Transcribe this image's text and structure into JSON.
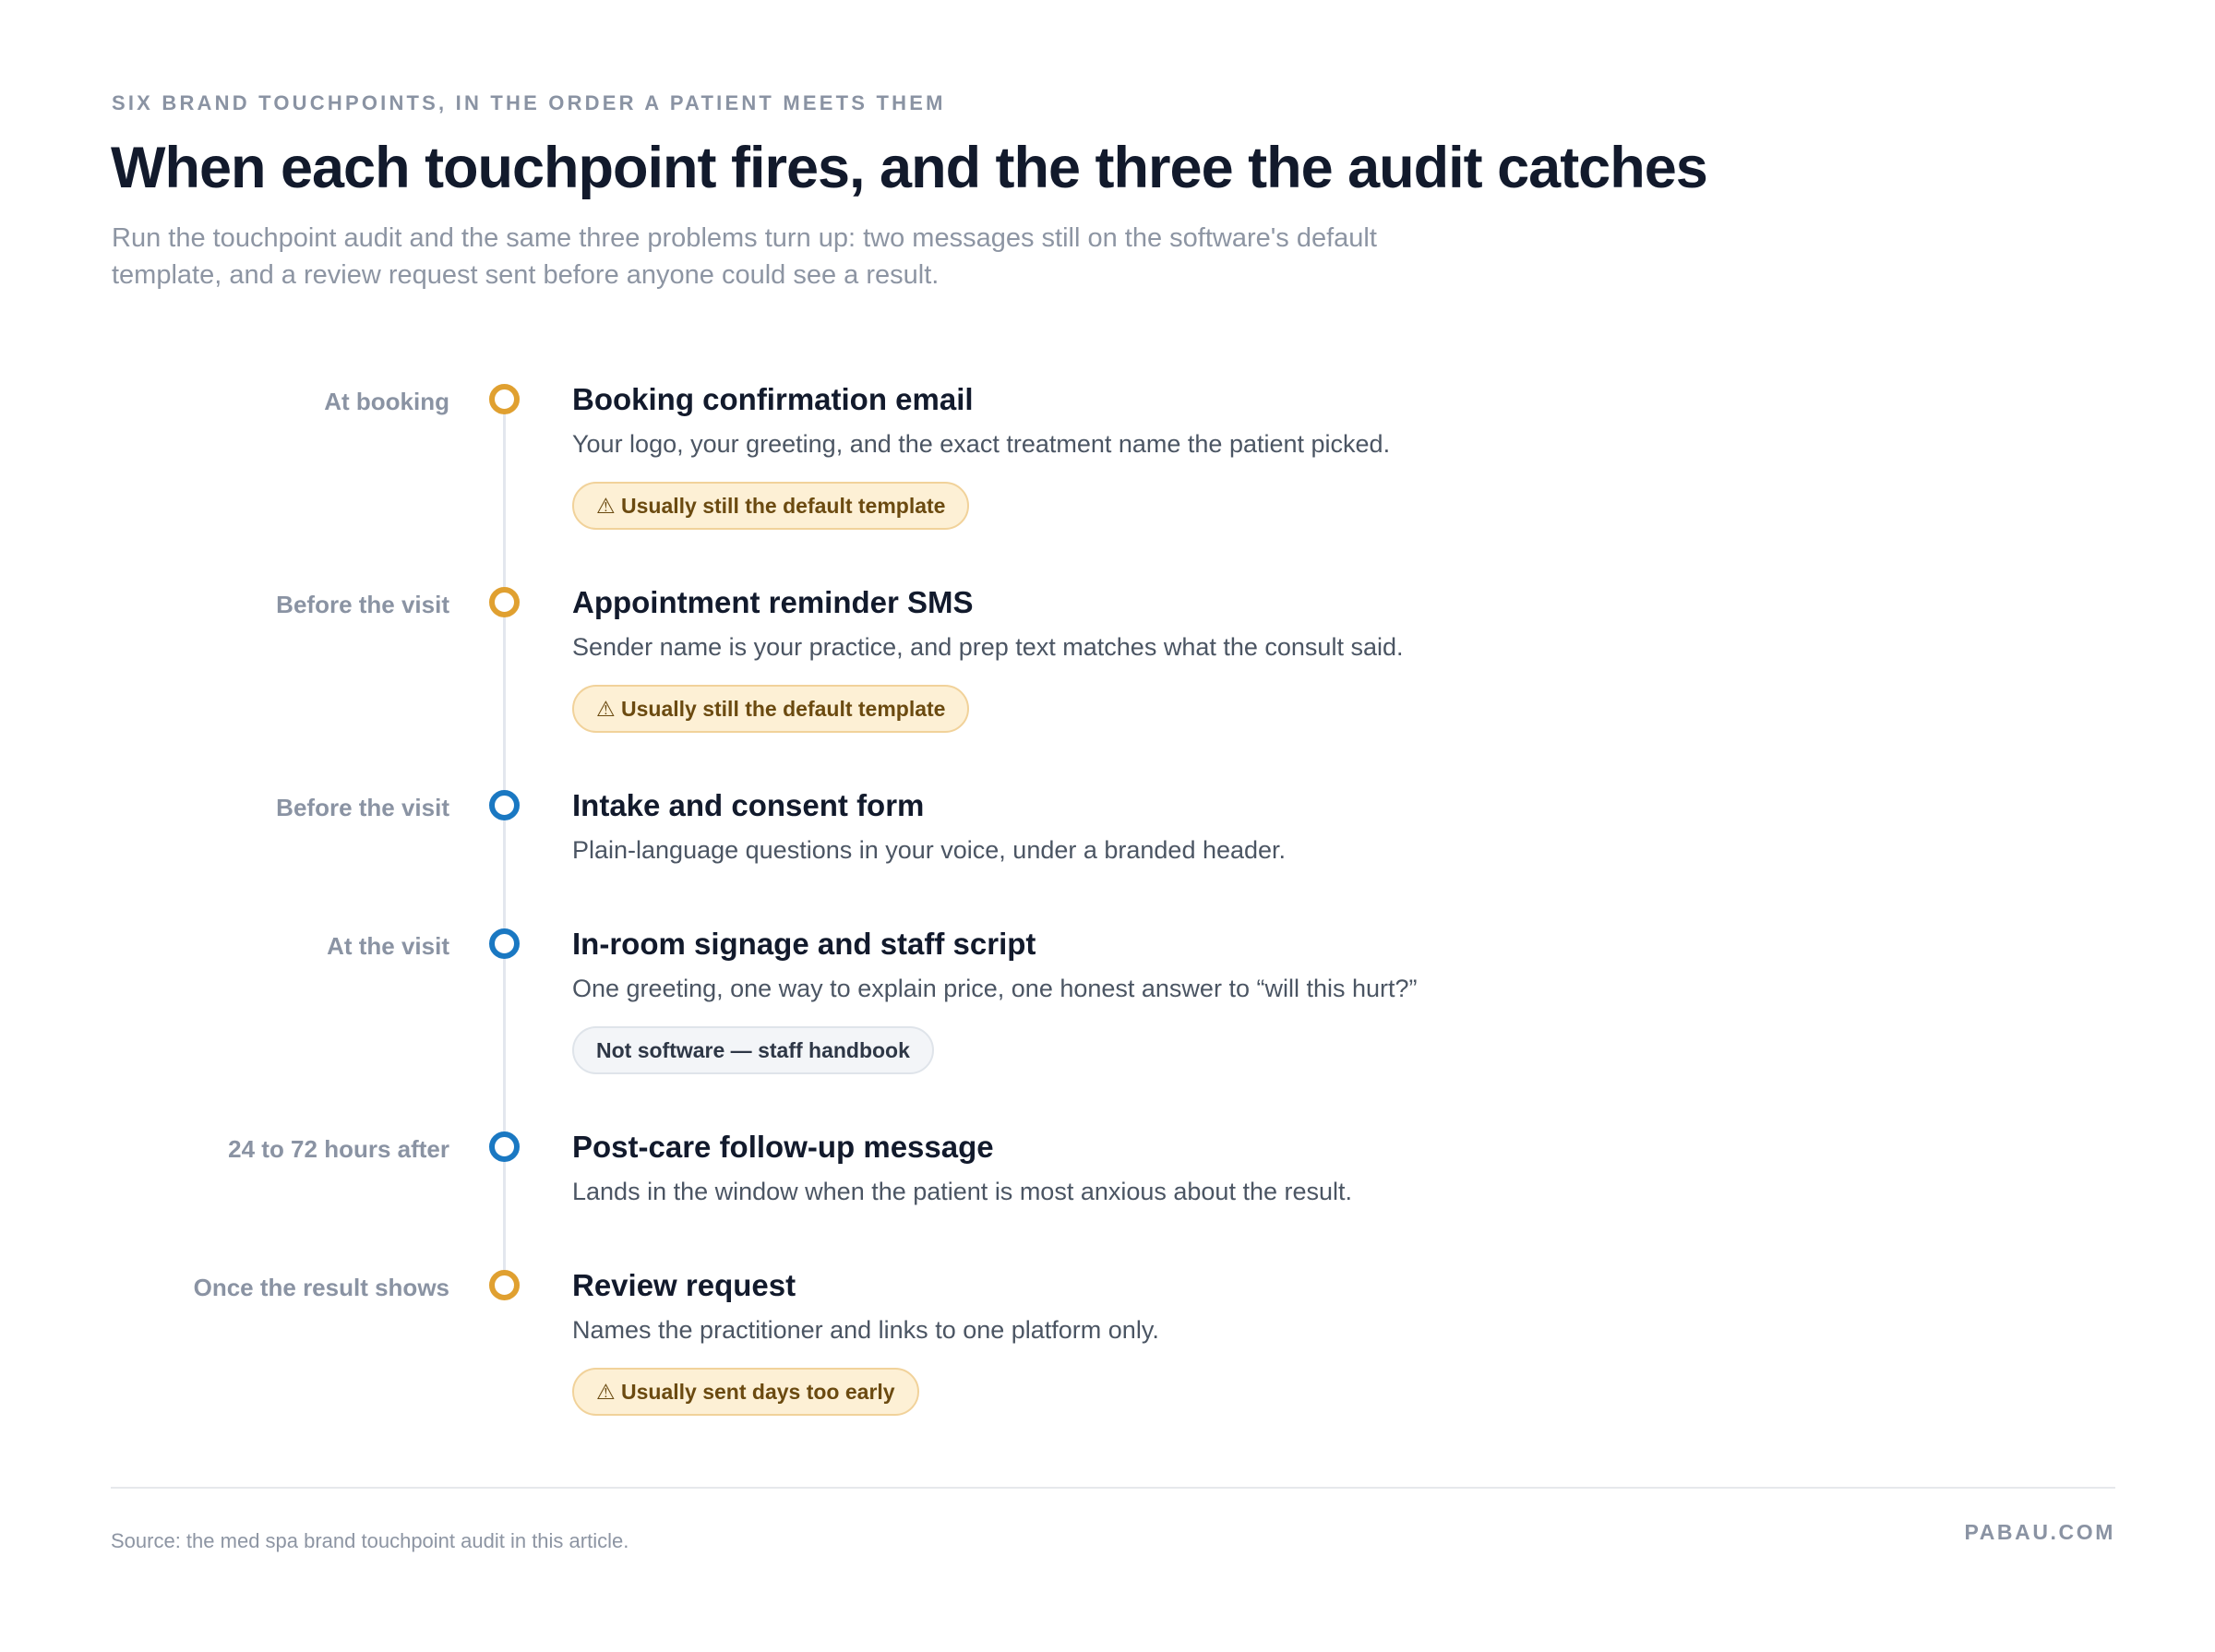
{
  "header": {
    "eyebrow": "SIX BRAND TOUCHPOINTS, IN THE ORDER A PATIENT MEETS THEM",
    "title": "When each touchpoint fires, and the three the audit catches",
    "subtitle": "Run the touchpoint audit and the same three problems turn up: two messages still on the software's default template, and a review request sent before anyone could see a result."
  },
  "colors": {
    "flagged_dot": "#e0a030",
    "ok_dot": "#1a78c2",
    "warning_badge_bg": "#fdf0d5",
    "neutral_badge_bg": "#f3f5f8",
    "title_text": "#121a2c"
  },
  "touchpoints": [
    {
      "when": "At booking",
      "title": "Booking confirmation email",
      "description": "Your logo, your greeting, and the exact treatment name the patient picked.",
      "marker": "flagged",
      "badge": "⚠ Usually still the default template",
      "badge_type": "warning"
    },
    {
      "when": "Before the visit",
      "title": "Appointment reminder SMS",
      "description": "Sender name is your practice, and prep text matches what the consult said.",
      "marker": "flagged",
      "badge": "⚠ Usually still the default template",
      "badge_type": "warning"
    },
    {
      "when": "Before the visit",
      "title": "Intake and consent form",
      "description": "Plain-language questions in your voice, under a branded header.",
      "marker": "ok"
    },
    {
      "when": "At the visit",
      "title": "In-room signage and staff script",
      "description": "One greeting, one way to explain price, one honest answer to “will this hurt?”",
      "marker": "ok",
      "badge": "Not software — staff handbook",
      "badge_type": "neutral"
    },
    {
      "when": "24 to 72 hours after",
      "title": "Post-care follow-up message",
      "description": "Lands in the window when the patient is most anxious about the result.",
      "marker": "ok"
    },
    {
      "when": "Once the result shows",
      "title": "Review request",
      "description": "Names the practitioner and links to one platform only.",
      "marker": "flagged",
      "badge": "⚠ Usually sent days too early",
      "badge_type": "warning"
    }
  ],
  "footer": {
    "source": "Source: the med spa brand touchpoint audit in this article.",
    "brand": "PABAU.COM"
  }
}
